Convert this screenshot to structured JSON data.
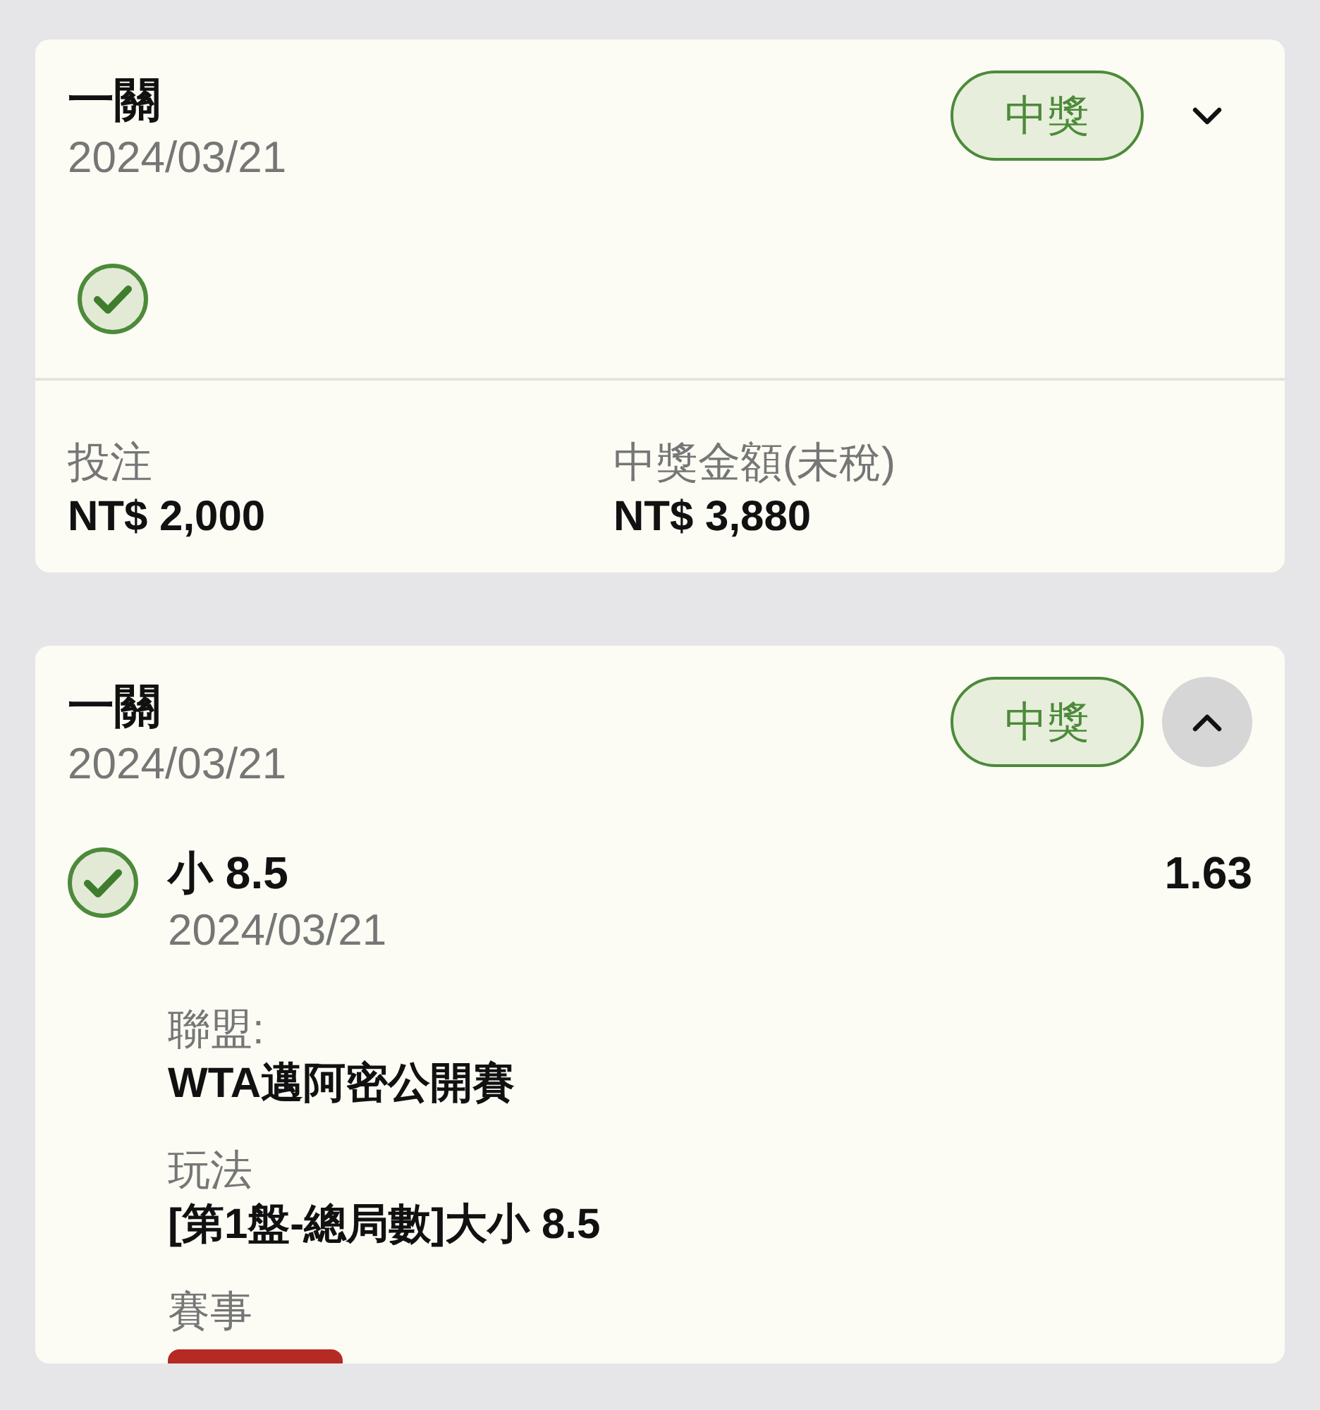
{
  "bets": [
    {
      "type": "一關",
      "date": "2024/03/21",
      "status": {
        "label": "中獎",
        "kind": "won"
      },
      "expanded": false,
      "legs": [
        {
          "kind": "won"
        }
      ],
      "summary": [
        {
          "label": "投注",
          "value": "NT$ 2,000"
        },
        {
          "label": "中獎金額(未稅)",
          "value": "NT$ 3,880"
        }
      ]
    },
    {
      "type": "一關",
      "date": "2024/03/21",
      "status": {
        "label": "中獎",
        "kind": "won"
      },
      "expanded": true,
      "legs": [
        {
          "kind": "won",
          "selection": "小 8.5",
          "date": "2024/03/21",
          "odds": "1.63",
          "details": [
            {
              "kind": "text",
              "label": "聯盟:",
              "value": "WTA邁阿密公開賽"
            },
            {
              "kind": "text",
              "label": "玩法",
              "value": "[第1盤-總局數]大小 8.5"
            },
            {
              "kind": "tag",
              "label": "賽事"
            }
          ]
        }
      ]
    }
  ]
}
